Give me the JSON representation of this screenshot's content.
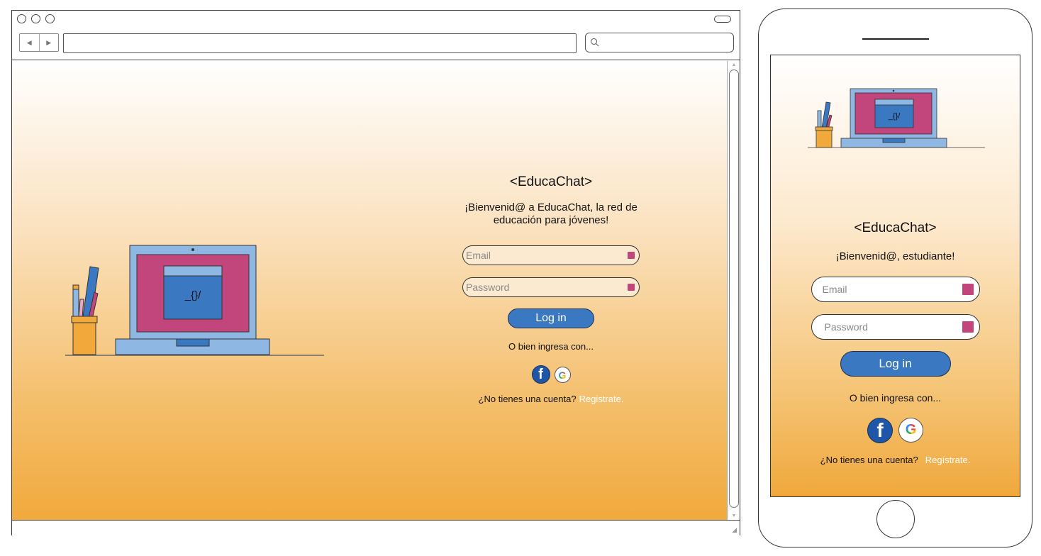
{
  "colors": {
    "accent": "#3b78c2",
    "pink": "#c2457b",
    "orange": "#f1a93c",
    "link": "#ffffff"
  },
  "desktop": {
    "illustration": {
      "screen_text": "_{}/"
    },
    "brand": "<EducaChat>",
    "welcome": "¡Bienvenid@ a EducaChat, la red de educación para jóvenes!",
    "email_placeholder": "Email",
    "password_placeholder": "Password",
    "login_label": "Log in",
    "alt_login": "O bien ingresa con...",
    "facebook_glyph": "f",
    "google_glyph": "G",
    "signup_prompt": "¿No tienes una cuenta?",
    "signup_link": "Registrate."
  },
  "mobile": {
    "illustration": {
      "screen_text": "_{}/"
    },
    "brand": "<EducaChat>",
    "welcome": "¡Bienvenid@, estudiante!",
    "email_placeholder": "Email",
    "password_placeholder": "Password",
    "login_label": "Log in",
    "alt_login": "O bien ingresa con...",
    "facebook_glyph": "f",
    "google_glyph": "G",
    "signup_prompt": "¿No tienes una cuenta?",
    "signup_link": "Regístrate."
  }
}
